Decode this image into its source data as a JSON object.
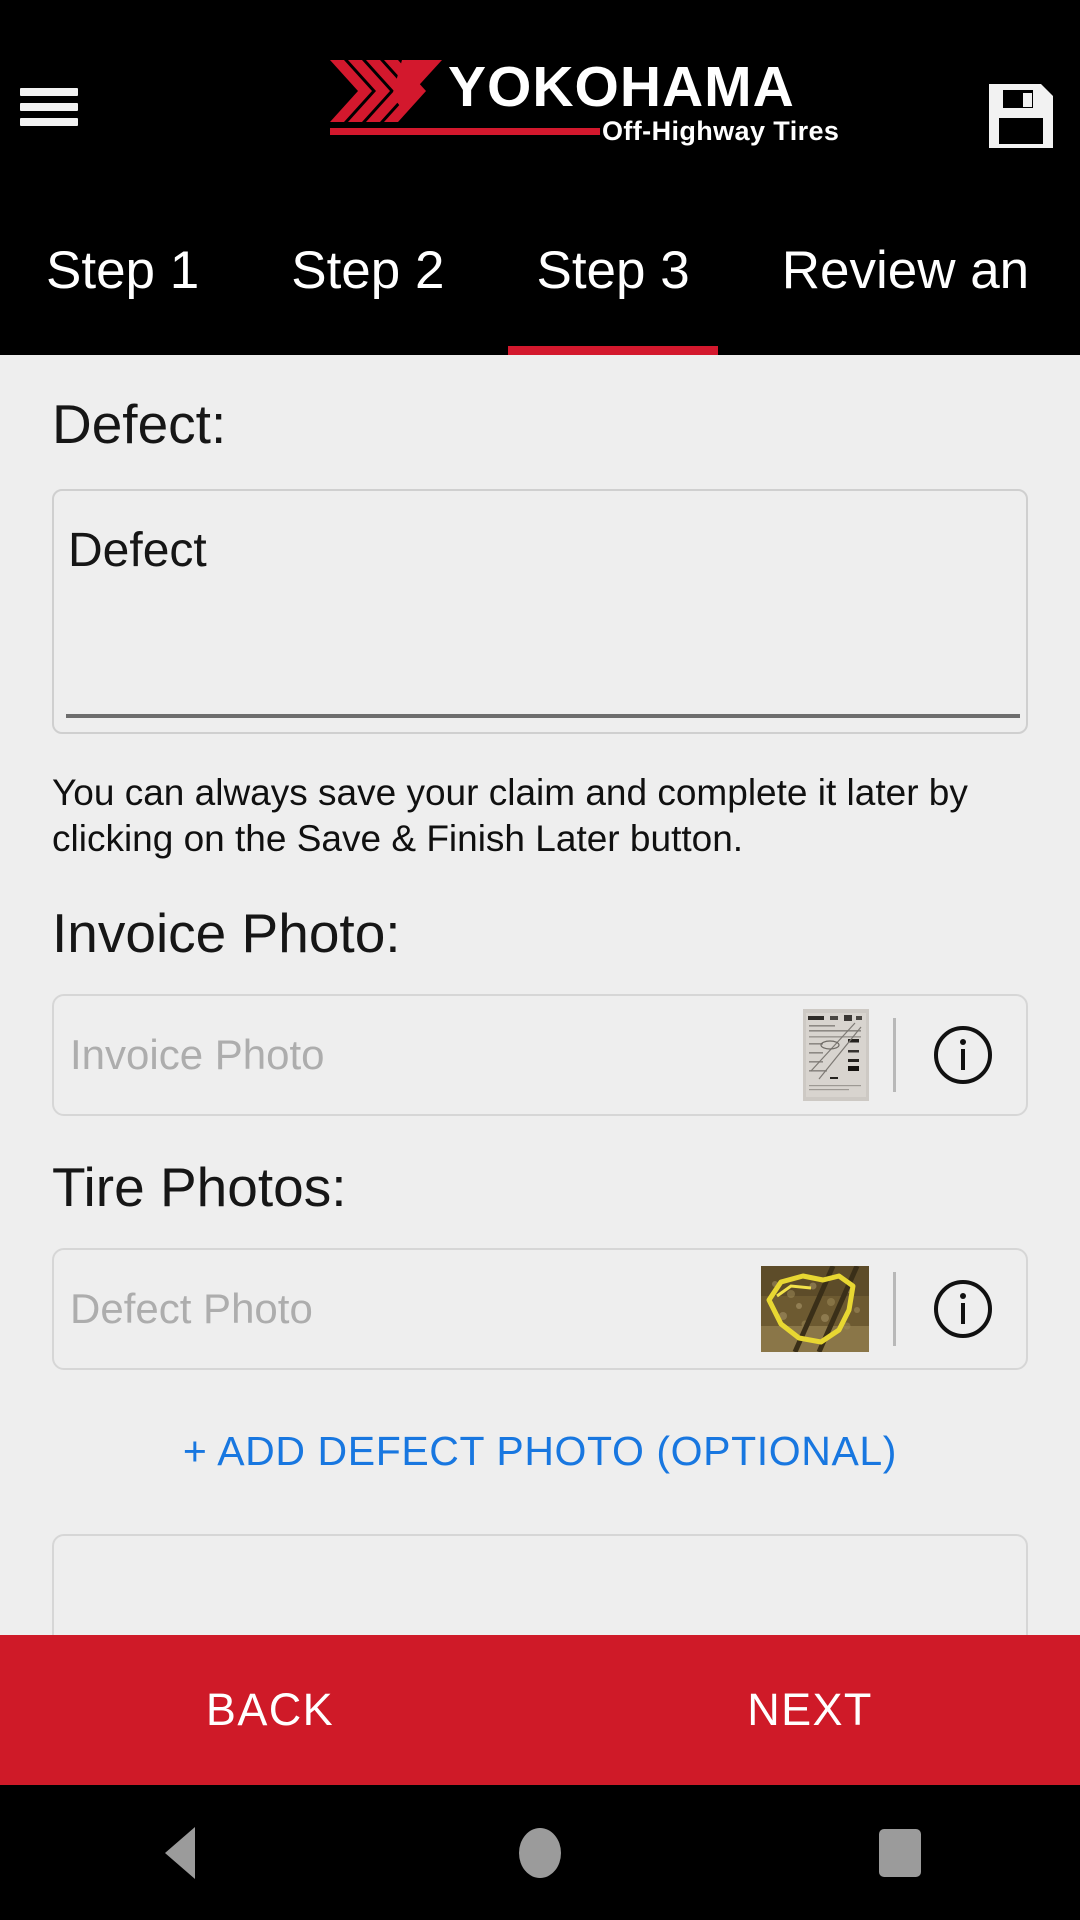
{
  "header": {
    "menu_icon": "hamburger-menu-icon",
    "save_icon": "floppy-disk-save-icon",
    "brand_name": "YOKOHAMA",
    "brand_tagline": "Off-Highway Tires",
    "brand_red": "#d3182d"
  },
  "tabs": {
    "items": [
      {
        "label": "Step 1",
        "active": false
      },
      {
        "label": "Step 2",
        "active": false
      },
      {
        "label": "Step 3",
        "active": true
      },
      {
        "label": "Review an",
        "active": false
      }
    ],
    "active_index": 2,
    "indicator_color": "#d3182d"
  },
  "main": {
    "defect_section": {
      "label": "Defect:",
      "field_value": "Defect",
      "field_placeholder": "Defect"
    },
    "helper_text": "You can always save your claim and complete it later by clicking on the Save & Finish Later button.",
    "invoice_section": {
      "label": "Invoice Photo:",
      "field_placeholder": "Invoice Photo",
      "thumbnail_name": "invoice-document-thumbnail",
      "info_icon": "info-circle-icon"
    },
    "tire_section": {
      "label": "Tire Photos:",
      "field_placeholder": "Defect Photo",
      "thumbnail_name": "tire-defect-photo-thumbnail",
      "info_icon": "info-circle-icon"
    },
    "add_photo_link": "+ ADD DEFECT PHOTO (OPTIONAL)",
    "add_photo_link_color": "#1877e0"
  },
  "bottom_bar": {
    "back_label": "BACK",
    "next_label": "NEXT",
    "background": "#cf1a28"
  },
  "system_nav": {
    "back_icon": "triangle-back-icon",
    "home_icon": "circle-home-icon",
    "recents_icon": "square-recents-icon"
  }
}
